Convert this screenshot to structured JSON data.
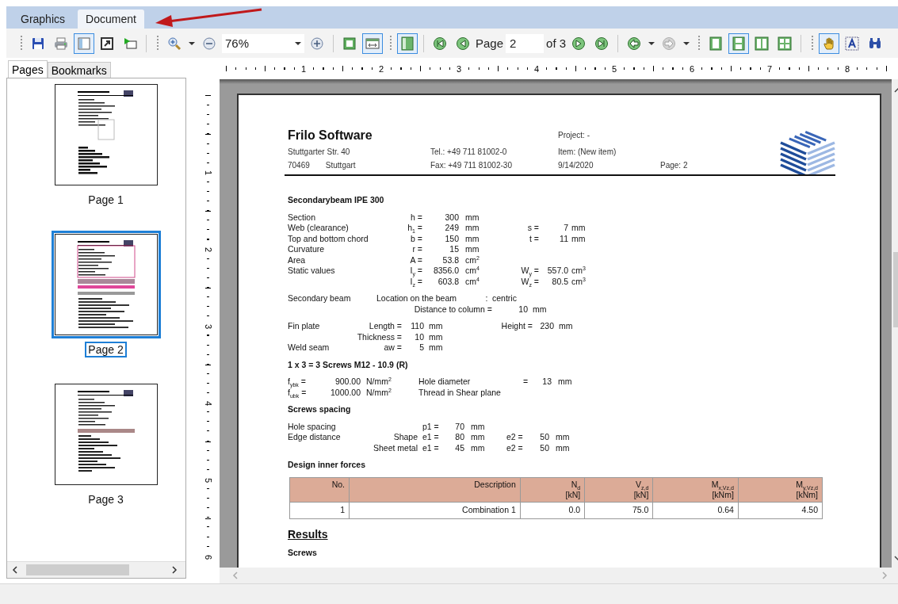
{
  "tabs": [
    {
      "label": "Graphics",
      "selected": false
    },
    {
      "label": "Document",
      "selected": true
    }
  ],
  "toolbar": {
    "buttons": [
      {
        "pressed": false,
        "disabled": false
      },
      {
        "pressed": false,
        "disabled": false
      },
      {
        "pressed": true,
        "disabled": false
      },
      {
        "pressed": false,
        "disabled": false
      },
      {
        "pressed": false,
        "disabled": false
      },
      {
        "pressed": false,
        "disabled": false
      },
      {
        "pressed": false,
        "disabled": false
      },
      {
        "pressed": false,
        "disabled": false
      },
      {
        "pressed": false,
        "disabled": false
      },
      {
        "pressed": true,
        "disabled": false
      },
      {
        "pressed": true,
        "disabled": false
      },
      {
        "pressed": false,
        "disabled": false
      },
      {
        "pressed": false,
        "disabled": false
      },
      {
        "pressed": false,
        "disabled": false
      },
      {
        "pressed": false,
        "disabled": false
      },
      {
        "pressed": false,
        "disabled": false
      },
      {
        "pressed": false,
        "disabled": true
      },
      {
        "pressed": false,
        "disabled": false
      },
      {
        "pressed": true,
        "disabled": false
      },
      {
        "pressed": false,
        "disabled": false
      },
      {
        "pressed": false,
        "disabled": false
      },
      {
        "pressed": true,
        "disabled": false
      },
      {
        "pressed": false,
        "disabled": false
      },
      {
        "pressed": false,
        "disabled": false
      }
    ],
    "zoom": "76%",
    "page_label": "Page",
    "page": "2",
    "page_count": "of 3"
  },
  "side_panel": {
    "tabs": [
      {
        "label": "Pages",
        "selected": true
      },
      {
        "label": "Bookmarks",
        "selected": false
      }
    ],
    "thumbnails": [
      {
        "label": "Page 1",
        "selected": false
      },
      {
        "label": "Page 2",
        "selected": true
      },
      {
        "label": "Page 3",
        "selected": false
      }
    ]
  },
  "ruler": {
    "horizontal": [
      "1",
      "2",
      "3",
      "4",
      "5",
      "6",
      "7",
      "8"
    ],
    "vertical": [
      "1",
      "2",
      "3",
      "4",
      "5",
      "6"
    ]
  },
  "document": {
    "header": {
      "company": "Frilo Software",
      "street": "Stuttgarter Str. 40",
      "postcode": "70469",
      "city": "Stuttgart",
      "phone": "Tel.: +49 711 81002-0",
      "fax": "Fax: +49 711 81002-30",
      "project": "Project: -",
      "item": "Item: (New item)",
      "date": "9/14/2020",
      "page": "Page: 2"
    },
    "sections": [
      {
        "kind": "heading",
        "text": "Secondarybeam IPE 300"
      },
      {
        "kind": "props",
        "rows": [
          {
            "label": "Section",
            "symbol": "h =",
            "value": "300",
            "unit": "mm"
          },
          {
            "label": "Web (clearance)",
            "symbol": "h$_{1}$ =",
            "value": "249",
            "unit": "mm",
            "symbol_2": "s =",
            "value_2": "7",
            "unit_2": "mm"
          },
          {
            "label": "Top and bottom chord",
            "symbol": "b =",
            "value": "150",
            "unit": "mm",
            "symbol_2": "t =",
            "value_2": "11",
            "unit_2": "mm"
          },
          {
            "label": "Curvature",
            "symbol": "r =",
            "value": "15",
            "unit": "mm"
          },
          {
            "label": "Area",
            "symbol": "A =",
            "value": "53.8",
            "unit": "cm$^{2}$"
          },
          {
            "label": "Static values",
            "symbol": "I$_{y}$ =",
            "value": "8356.0",
            "unit": "cm$^{4}$",
            "symbol_2": "W$_{y}$ =",
            "value_2": "557.0",
            "unit_2": "cm$^{3}$"
          },
          {
            "symbol": "I$_{z}$ =",
            "value": "603.8",
            "unit": "cm$^{4}$",
            "symbol_2": "W$_{z}$ =",
            "value_2": "80.5",
            "unit_2": "cm$^{3}$"
          }
        ]
      },
      {
        "kind": "placement",
        "rows": [
          {
            "label": "Secondary beam",
            "name": "Location on the beam",
            "separator": ":",
            "value": "centric"
          },
          {
            "name_right": "Distance to column =",
            "amount": "10",
            "unit": "mm"
          }
        ]
      },
      {
        "kind": "fin",
        "rows": [
          {
            "label": "Fin plate",
            "symbol": "Length =",
            "value": "110",
            "unit": "mm",
            "symbol_2": "Height =",
            "value_2": "230",
            "unit_2": "mm"
          },
          {
            "symbol": "Thickness =",
            "value": "10",
            "unit": "mm"
          },
          {
            "label": "Weld seam",
            "symbol": "aw =",
            "value": "5",
            "unit": "mm"
          }
        ]
      },
      {
        "kind": "heading",
        "text": "1 x 3 = 3 Screws M12 - 10.9 (R)"
      },
      {
        "kind": "bolt",
        "rows": [
          {
            "symbol": "f$_{ybk}$ =",
            "value": "900.00",
            "unit": "N/mm$^{2}$",
            "name": "Hole diameter",
            "symbol_2": "=",
            "value_2": "13",
            "unit_2": "mm"
          },
          {
            "symbol": "f$_{ubk}$ =",
            "value": "1000.00",
            "unit": "N/mm$^{2}$",
            "name": "Thread in Shear plane"
          }
        ]
      },
      {
        "kind": "heading",
        "text": "Screws spacing"
      },
      {
        "kind": "spacing",
        "rows": [
          {
            "label": "Hole spacing",
            "symbol": "p1 =",
            "value": "70",
            "unit": "mm"
          },
          {
            "label": "Edge distance",
            "name_right": "Shape",
            "symbol": "e1 =",
            "value": "80",
            "unit": "mm",
            "symbol_2": "e2 =",
            "value_2": "50",
            "unit_2": "mm"
          },
          {
            "name_right": "Sheet metal",
            "symbol": "e1 =",
            "value": "45",
            "unit": "mm",
            "symbol_2": "e2 =",
            "value_2": "50",
            "unit_2": "mm"
          }
        ]
      },
      {
        "kind": "heading",
        "text": "Design inner forces"
      },
      {
        "kind": "table",
        "columns": [
          {
            "name": "No."
          },
          {
            "name": "Description"
          },
          {
            "name": "N$_{d}$",
            "unit": "[kN]"
          },
          {
            "name": "V$_{z,d}$",
            "unit": "[kN]"
          },
          {
            "name": "M$_{x,Vz,d}$",
            "unit": "[kNm]"
          },
          {
            "name": "M$_{y,Vz,d}$",
            "unit": "[kNm]"
          }
        ],
        "rows": [
          [
            "1",
            "Combination 1",
            "0.0",
            "75.0",
            "0.64",
            "4.50"
          ]
        ]
      },
      {
        "kind": "title",
        "text": "Results"
      },
      {
        "kind": "heading",
        "text": "Screws"
      }
    ]
  }
}
